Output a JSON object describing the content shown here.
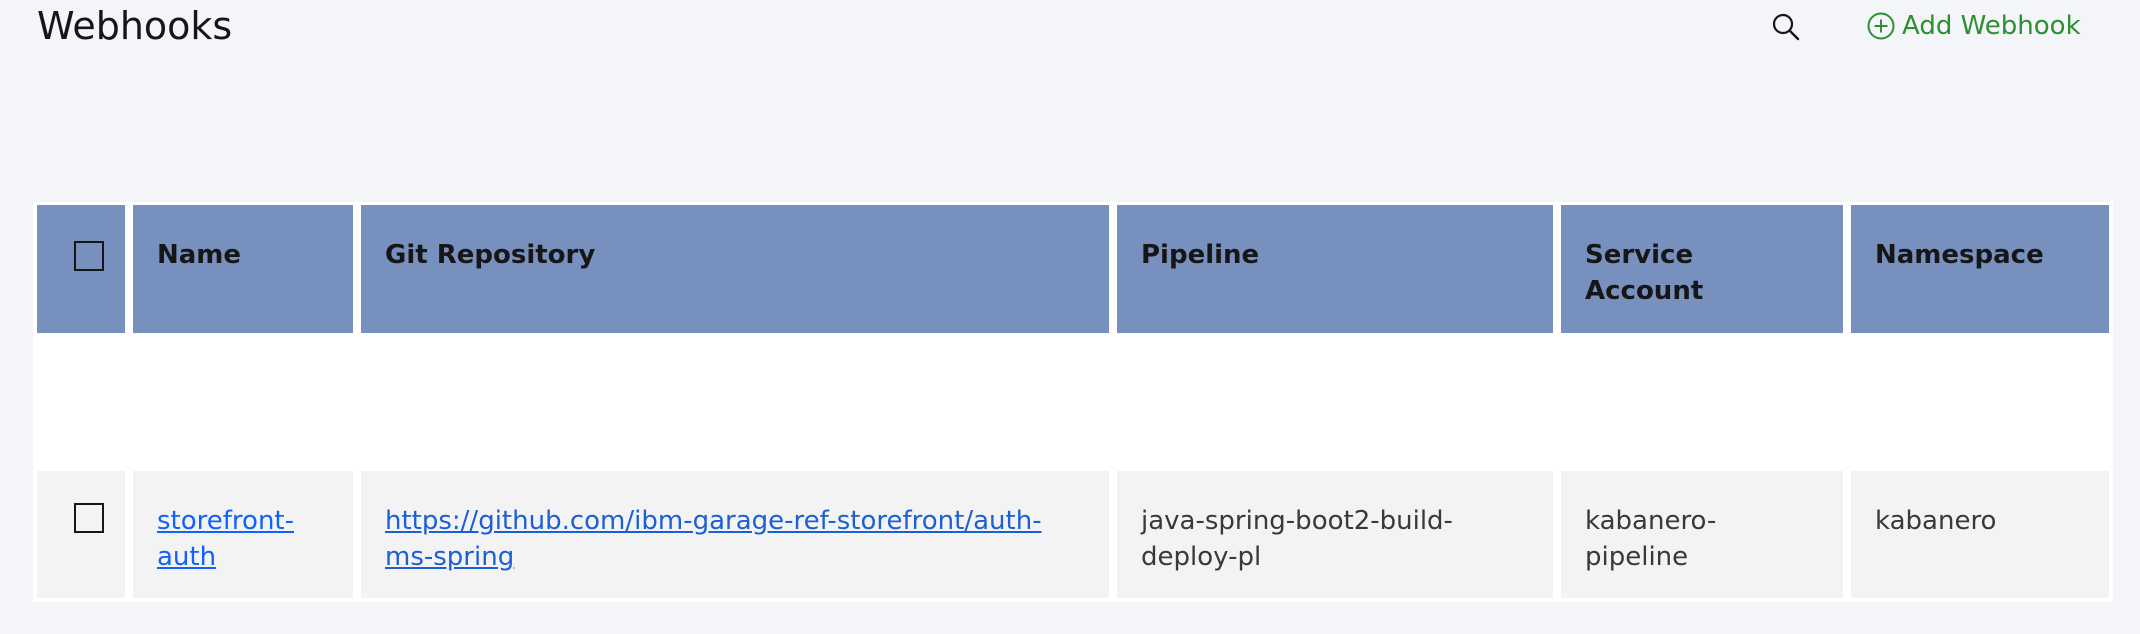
{
  "header": {
    "title": "Webhooks",
    "add_label": "Add Webhook"
  },
  "icons": {
    "search": "search-icon",
    "add": "add-circle-icon"
  },
  "colors": {
    "table_header": "#7890be",
    "accent_green": "#24a148",
    "link": "#0f62fe"
  },
  "table": {
    "columns": [
      "",
      "Name",
      "Git Repository",
      "Pipeline",
      "Service Account",
      "Namespace"
    ],
    "column_display": {
      "name": "Name",
      "repo": "Git Repository",
      "pipeline": "Pipeline",
      "service_account_1": "Service",
      "service_account_2": "Account",
      "namespace": "Namespace"
    },
    "rows": [
      {
        "selected": false,
        "name_1": "storefront-",
        "name_2": "auth",
        "repo_1": "https://github.com/ibm-garage-ref-storefront/auth-",
        "repo_2": "ms-spring",
        "pipeline_1": "java-spring-boot2-build-",
        "pipeline_2": "deploy-pl",
        "service_account_1": "kabanero-",
        "service_account_2": "pipeline",
        "namespace": "kabanero"
      }
    ]
  }
}
